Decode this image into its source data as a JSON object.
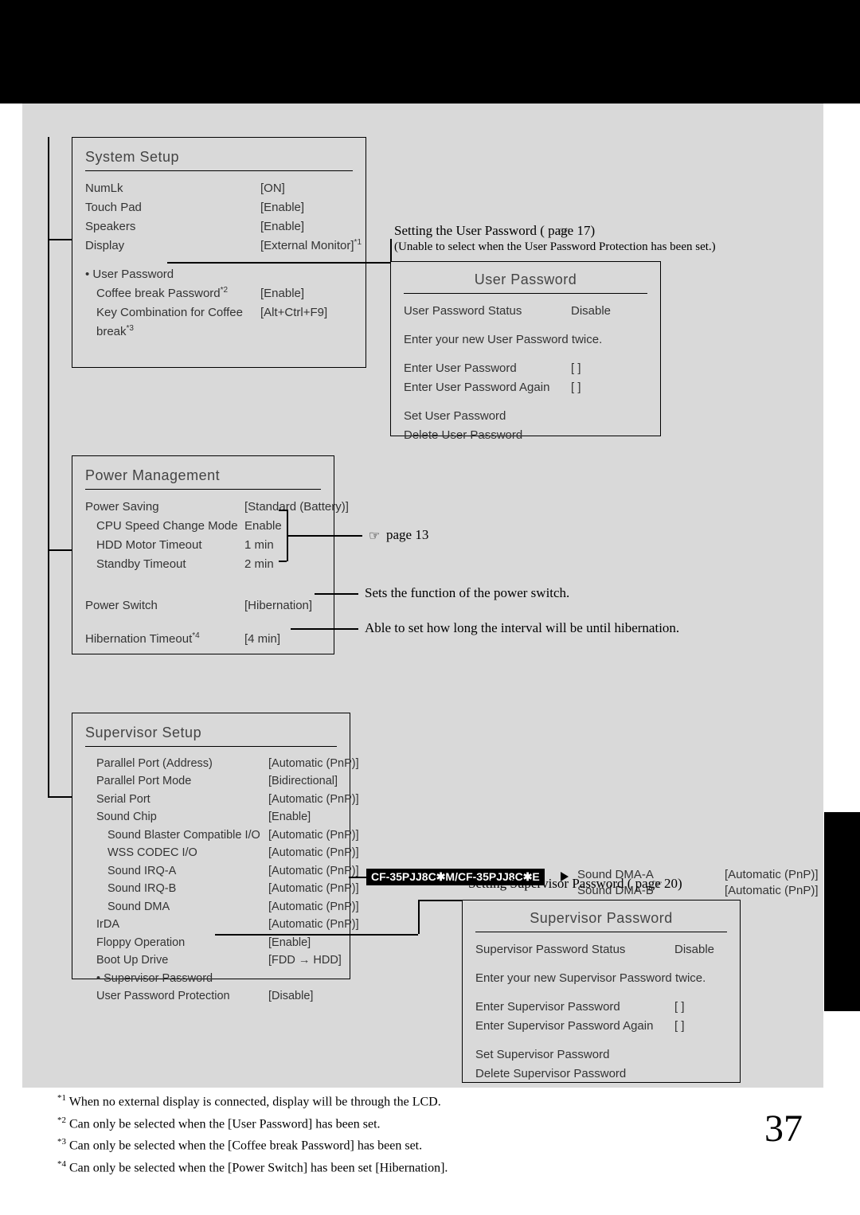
{
  "page_number": "37",
  "system_setup": {
    "title": "System Setup",
    "rows": [
      {
        "label": "NumLk",
        "value": "[ON]"
      },
      {
        "label": "Touch Pad",
        "value": "[Enable]"
      },
      {
        "label": "Speakers",
        "value": "[Enable]"
      },
      {
        "label": "Display",
        "value": "[External Monitor]",
        "sup": "*1"
      }
    ],
    "user_password_label": "User Password",
    "coffee_break_pw": {
      "label": "Coffee break Password",
      "sup": "*2",
      "value": "[Enable]"
    },
    "key_combo": {
      "label": "Key Combination for Coffee break",
      "sup": "*3",
      "value": "[Alt+Ctrl+F9]"
    }
  },
  "user_password_note": {
    "heading": "Setting the User Password (        page 17)",
    "sub": "(Unable to select when the User Password Protection has been set.)"
  },
  "user_password_box": {
    "title": "User Password",
    "status_label": "User Password Status",
    "status_value": "Disable",
    "instruct": "Enter your new User Password twice.",
    "enter_label": "Enter User Password",
    "enter_value": "[                    ]",
    "enter_again_label": "Enter User Password Again",
    "enter_again_value": "[                    ]",
    "set_label": "Set User Password",
    "delete_label": "Delete User Password"
  },
  "power_mgmt": {
    "title": "Power Management",
    "power_saving": {
      "label": "Power Saving",
      "value": "[Standard (Battery)]"
    },
    "cpu_speed": {
      "label": "CPU Speed Change Mode",
      "value": "Enable"
    },
    "hdd_timeout": {
      "label": "HDD Motor Timeout",
      "value": "1 min"
    },
    "standby_timeout": {
      "label": "Standby Timeout",
      "value": "2 min"
    },
    "power_switch": {
      "label": "Power Switch",
      "value": "[Hibernation]"
    },
    "hibernation_timeout": {
      "label": "Hibernation Timeout",
      "sup": "*4",
      "value": "[4 min]"
    }
  },
  "power_notes": {
    "page13": "page 13",
    "power_switch_note": "Sets the function of the power switch.",
    "hibernation_note": "Able to set how long the interval will be until hibernation."
  },
  "supervisor_setup": {
    "title": "Supervisor Setup",
    "rows": [
      {
        "label": "Parallel Port (Address)",
        "value": "[Automatic (PnP)]",
        "indent": 1
      },
      {
        "label": "Parallel Port Mode",
        "value": "[Bidirectional]",
        "indent": 1
      },
      {
        "label": "Serial Port",
        "value": "[Automatic (PnP)]",
        "indent": 1
      },
      {
        "label": "Sound Chip",
        "value": "[Enable]",
        "indent": 1
      },
      {
        "label": "Sound Blaster Compatible I/O",
        "value": "[Automatic (PnP)]",
        "indent": 2
      },
      {
        "label": "WSS CODEC I/O",
        "value": "[Automatic (PnP)]",
        "indent": 2
      },
      {
        "label": "Sound IRQ-A",
        "value": "[Automatic (PnP)]",
        "indent": 2
      },
      {
        "label": "Sound IRQ-B",
        "value": "[Automatic (PnP)]",
        "indent": 2
      },
      {
        "label": "Sound DMA",
        "value": "[Automatic (PnP)]",
        "indent": 2
      },
      {
        "label": "IrDA",
        "value": "[Automatic (PnP)]",
        "indent": 1
      },
      {
        "label": "Floppy Operation",
        "value": "[Enable]",
        "indent": 1
      },
      {
        "label": "Boot Up Drive",
        "value": "[FDD  →  HDD]",
        "indent": 1
      }
    ],
    "supervisor_password_label": "Supervisor Password",
    "user_pw_protection": {
      "label": "User Password Protection",
      "value": "[Disable]"
    }
  },
  "model_badge": "CF-35PJJ8C✱M/CF-35PJJ8C✱E",
  "sound_dma_a": {
    "label": "Sound DMA-A",
    "value": "[Automatic (PnP)]"
  },
  "sound_dma_b": {
    "label": "Sound DMA-B",
    "value": "[Automatic (PnP)]"
  },
  "supervisor_pw_note": "Setting Supervisor Password (        page 20)",
  "supervisor_pw_box": {
    "title": "Supervisor Password",
    "status_label": "Supervisor Password Status",
    "status_value": "Disable",
    "instruct": "Enter your new Supervisor Password twice.",
    "enter_label": "Enter Supervisor Password",
    "enter_value": "[              ]",
    "enter_again_label": "Enter Supervisor Password Again",
    "enter_again_value": "[              ]",
    "set_label": "Set Supervisor Password",
    "delete_label": "Delete Supervisor Password"
  },
  "footnotes": {
    "f1": "When no external display is connected, display will be through the LCD.",
    "f2": "Can only be selected when the [User Password] has been set.",
    "f3": "Can only be selected when the [Coffee break Password] has been set.",
    "f4": "Can only be selected when the [Power Switch] has been set [Hibernation]."
  }
}
